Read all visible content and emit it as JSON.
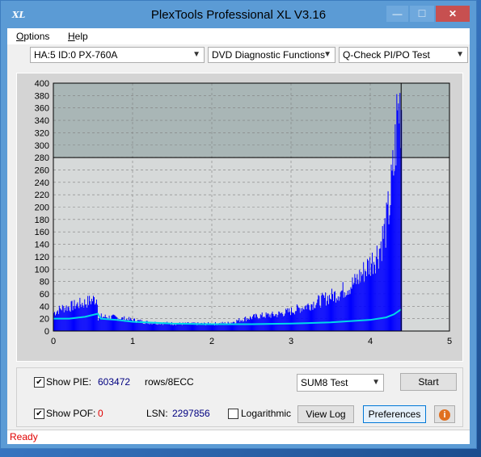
{
  "window": {
    "title": "PlexTools Professional XL V3.16",
    "icon_text": "XL",
    "min_label": "—",
    "max_label": "☐",
    "close_label": "✕"
  },
  "menu": {
    "options_first": "O",
    "options_rest": "ptions",
    "help_first": "H",
    "help_rest": "elp"
  },
  "toolbar": {
    "drive": "HA:5 ID:0  PX-760A",
    "function": "DVD Diagnostic Functions",
    "test": "Q-Check PI/PO Test"
  },
  "chart_data": {
    "type": "area",
    "xlabel": "",
    "ylabel": "",
    "xlim": [
      0,
      5
    ],
    "ylim": [
      0,
      400
    ],
    "x_ticks": [
      "0",
      "1",
      "2",
      "3",
      "4",
      "5"
    ],
    "y_ticks": [
      "0",
      "20",
      "40",
      "60",
      "80",
      "100",
      "120",
      "140",
      "160",
      "180",
      "200",
      "220",
      "240",
      "260",
      "280",
      "300",
      "320",
      "340",
      "360",
      "380",
      "400"
    ],
    "threshold_line": 280,
    "end_marker_x": 4.39,
    "colors": {
      "bars": "#0000ff",
      "average": "#00d8e8",
      "upper_band": "#a9b6b6",
      "lower_band": "#d6d9d9"
    },
    "series": [
      {
        "type": "bars",
        "x": [
          0.0,
          0.1,
          0.2,
          0.3,
          0.4,
          0.5,
          0.56,
          0.6,
          0.8,
          1.0,
          1.2,
          1.4,
          1.6,
          1.8,
          2.0,
          2.2,
          2.4,
          2.6,
          2.8,
          3.0,
          3.2,
          3.4,
          3.6,
          3.8,
          4.0,
          4.1,
          4.2,
          4.25,
          4.3,
          4.33,
          4.36,
          4.39
        ],
        "values": [
          30,
          38,
          40,
          44,
          47,
          52,
          54,
          24,
          22,
          18,
          14,
          13,
          12,
          12,
          12,
          13,
          20,
          25,
          27,
          33,
          42,
          52,
          63,
          80,
          112,
          132,
          175,
          220,
          280,
          345,
          370,
          375
        ]
      },
      {
        "type": "line",
        "x": [
          0.0,
          0.2,
          0.4,
          0.56,
          0.6,
          0.8,
          1.0,
          1.5,
          2.0,
          2.5,
          3.0,
          3.5,
          4.0,
          4.2,
          4.3,
          4.39
        ],
        "values": [
          20,
          20,
          23,
          28,
          20,
          18,
          15,
          12,
          11,
          11,
          12,
          14,
          18,
          22,
          27,
          35
        ]
      }
    ]
  },
  "controls": {
    "show_pie_label": "Show PIE:",
    "pie_value": "603472",
    "pie_unit": "rows/8ECC",
    "show_pof_label": "Show POF:",
    "pof_value": "0",
    "lsn_label": "LSN:",
    "lsn_value": "2297856",
    "logarithmic_label": "Logarithmic",
    "sum_select": "SUM8 Test",
    "start_button": "Start",
    "view_log_button": "View Log",
    "preferences_button": "Preferences",
    "info_button": "i",
    "show_pie_checked": true,
    "show_pof_checked": true,
    "logarithmic_checked": false
  },
  "status": {
    "text": "Ready"
  }
}
